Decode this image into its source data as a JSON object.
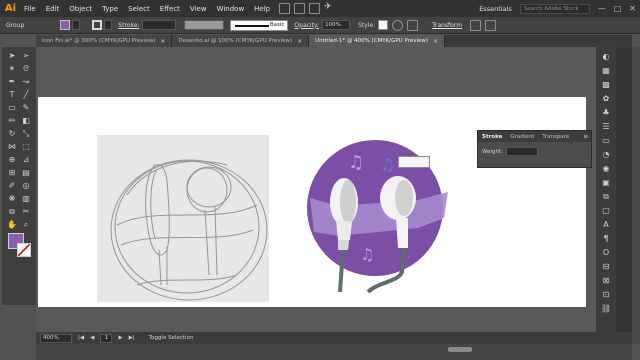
{
  "app": {
    "logo": "Ai",
    "menu": [
      "File",
      "Edit",
      "Object",
      "Type",
      "Select",
      "Effect",
      "View",
      "Window",
      "Help"
    ],
    "workspace": "Essentials",
    "search_placeholder": "Search Adobe Stock",
    "window_controls": [
      "—",
      "□",
      "✕"
    ]
  },
  "control_bar": {
    "selection_label": "Group",
    "stroke_label": "Stroke:",
    "brush_label": "Basic",
    "opacity_label": "Opacity:",
    "opacity_value": "100%",
    "style_label": "Style:",
    "transform_label": "Transform",
    "fill_color": "#8a5fb4"
  },
  "tabs": [
    {
      "label": "Icon Fei.ai* @ 300% (CMYK/GPU Preview)",
      "close": "×",
      "active": false
    },
    {
      "label": "Desenho.ai @ 100% (CMYK/GPU Preview)",
      "close": "×",
      "active": false
    },
    {
      "label": "Untitled-1* @ 400% (CMYK/GPU Preview)",
      "close": "×",
      "active": true
    }
  ],
  "tools": [
    {
      "icon": "selection-icon",
      "glyph": "➤"
    },
    {
      "icon": "direct-selection-icon",
      "glyph": "➢"
    },
    {
      "icon": "magic-wand-icon",
      "glyph": "✴"
    },
    {
      "icon": "lasso-icon",
      "glyph": "ᘓ"
    },
    {
      "icon": "pen-icon",
      "glyph": "✒"
    },
    {
      "icon": "curvature-icon",
      "glyph": "↝"
    },
    {
      "icon": "type-icon",
      "glyph": "T"
    },
    {
      "icon": "line-icon",
      "glyph": "╱"
    },
    {
      "icon": "rectangle-icon",
      "glyph": "▭"
    },
    {
      "icon": "paintbrush-icon",
      "glyph": "✎"
    },
    {
      "icon": "pencil-icon",
      "glyph": "✏"
    },
    {
      "icon": "eraser-icon",
      "glyph": "◧"
    },
    {
      "icon": "rotate-icon",
      "glyph": "↻"
    },
    {
      "icon": "scale-icon",
      "glyph": "⤡"
    },
    {
      "icon": "width-icon",
      "glyph": "⋈"
    },
    {
      "icon": "free-transform-icon",
      "glyph": "⬚"
    },
    {
      "icon": "shape-builder-icon",
      "glyph": "⊕"
    },
    {
      "icon": "perspective-icon",
      "glyph": "⊿"
    },
    {
      "icon": "mesh-icon",
      "glyph": "⊞"
    },
    {
      "icon": "gradient-icon",
      "glyph": "▤"
    },
    {
      "icon": "eyedropper-icon",
      "glyph": "✐"
    },
    {
      "icon": "blend-icon",
      "glyph": "◎"
    },
    {
      "icon": "symbol-sprayer-icon",
      "glyph": "❋"
    },
    {
      "icon": "graph-icon",
      "glyph": "▥"
    },
    {
      "icon": "artboard-icon",
      "glyph": "⧉"
    },
    {
      "icon": "slice-icon",
      "glyph": "✂"
    },
    {
      "icon": "hand-icon",
      "glyph": "✋"
    },
    {
      "icon": "zoom-icon",
      "glyph": "⌕"
    }
  ],
  "dock": [
    {
      "icon": "color-icon",
      "glyph": "◐"
    },
    {
      "icon": "color-guide-icon",
      "glyph": "▦"
    },
    {
      "icon": "swatches-icon",
      "glyph": "▩"
    },
    {
      "icon": "brushes-icon",
      "glyph": "✿"
    },
    {
      "icon": "symbols-icon",
      "glyph": "♣"
    },
    {
      "icon": "stroke-icon",
      "glyph": "☰"
    },
    {
      "icon": "gradient-panel-icon",
      "glyph": "▭"
    },
    {
      "icon": "transparency-icon",
      "glyph": "◔"
    },
    {
      "icon": "appearance-icon",
      "glyph": "◉"
    },
    {
      "icon": "graphic-styles-icon",
      "glyph": "▣"
    },
    {
      "icon": "layers-icon",
      "glyph": "⧉"
    },
    {
      "icon": "artboards-icon",
      "glyph": "▢"
    },
    {
      "icon": "character-icon",
      "glyph": "A"
    },
    {
      "icon": "paragraph-icon",
      "glyph": "¶"
    },
    {
      "icon": "opentype-icon",
      "glyph": "O"
    },
    {
      "icon": "align-icon",
      "glyph": "⊟"
    },
    {
      "icon": "pathfinder-icon",
      "glyph": "⊠"
    },
    {
      "icon": "transform-panel-icon",
      "glyph": "⊡"
    },
    {
      "icon": "links-icon",
      "glyph": "⛓"
    }
  ],
  "stroke_panel": {
    "tabs": [
      "Stroke",
      "Gradient",
      "Transpare"
    ],
    "weight_label": "Weight:"
  },
  "status_bar": {
    "zoom": "400%",
    "page": "1",
    "tool_hint": "Toggle Selection"
  },
  "colors": {
    "accent_purple": "#7b4fa6",
    "light_purple": "#a58ad0",
    "earbud_white": "#f3f3f3",
    "cable_gray": "#5f6b73",
    "note_color": "#b9a3dc",
    "note_blue": "#5d7ec8"
  }
}
